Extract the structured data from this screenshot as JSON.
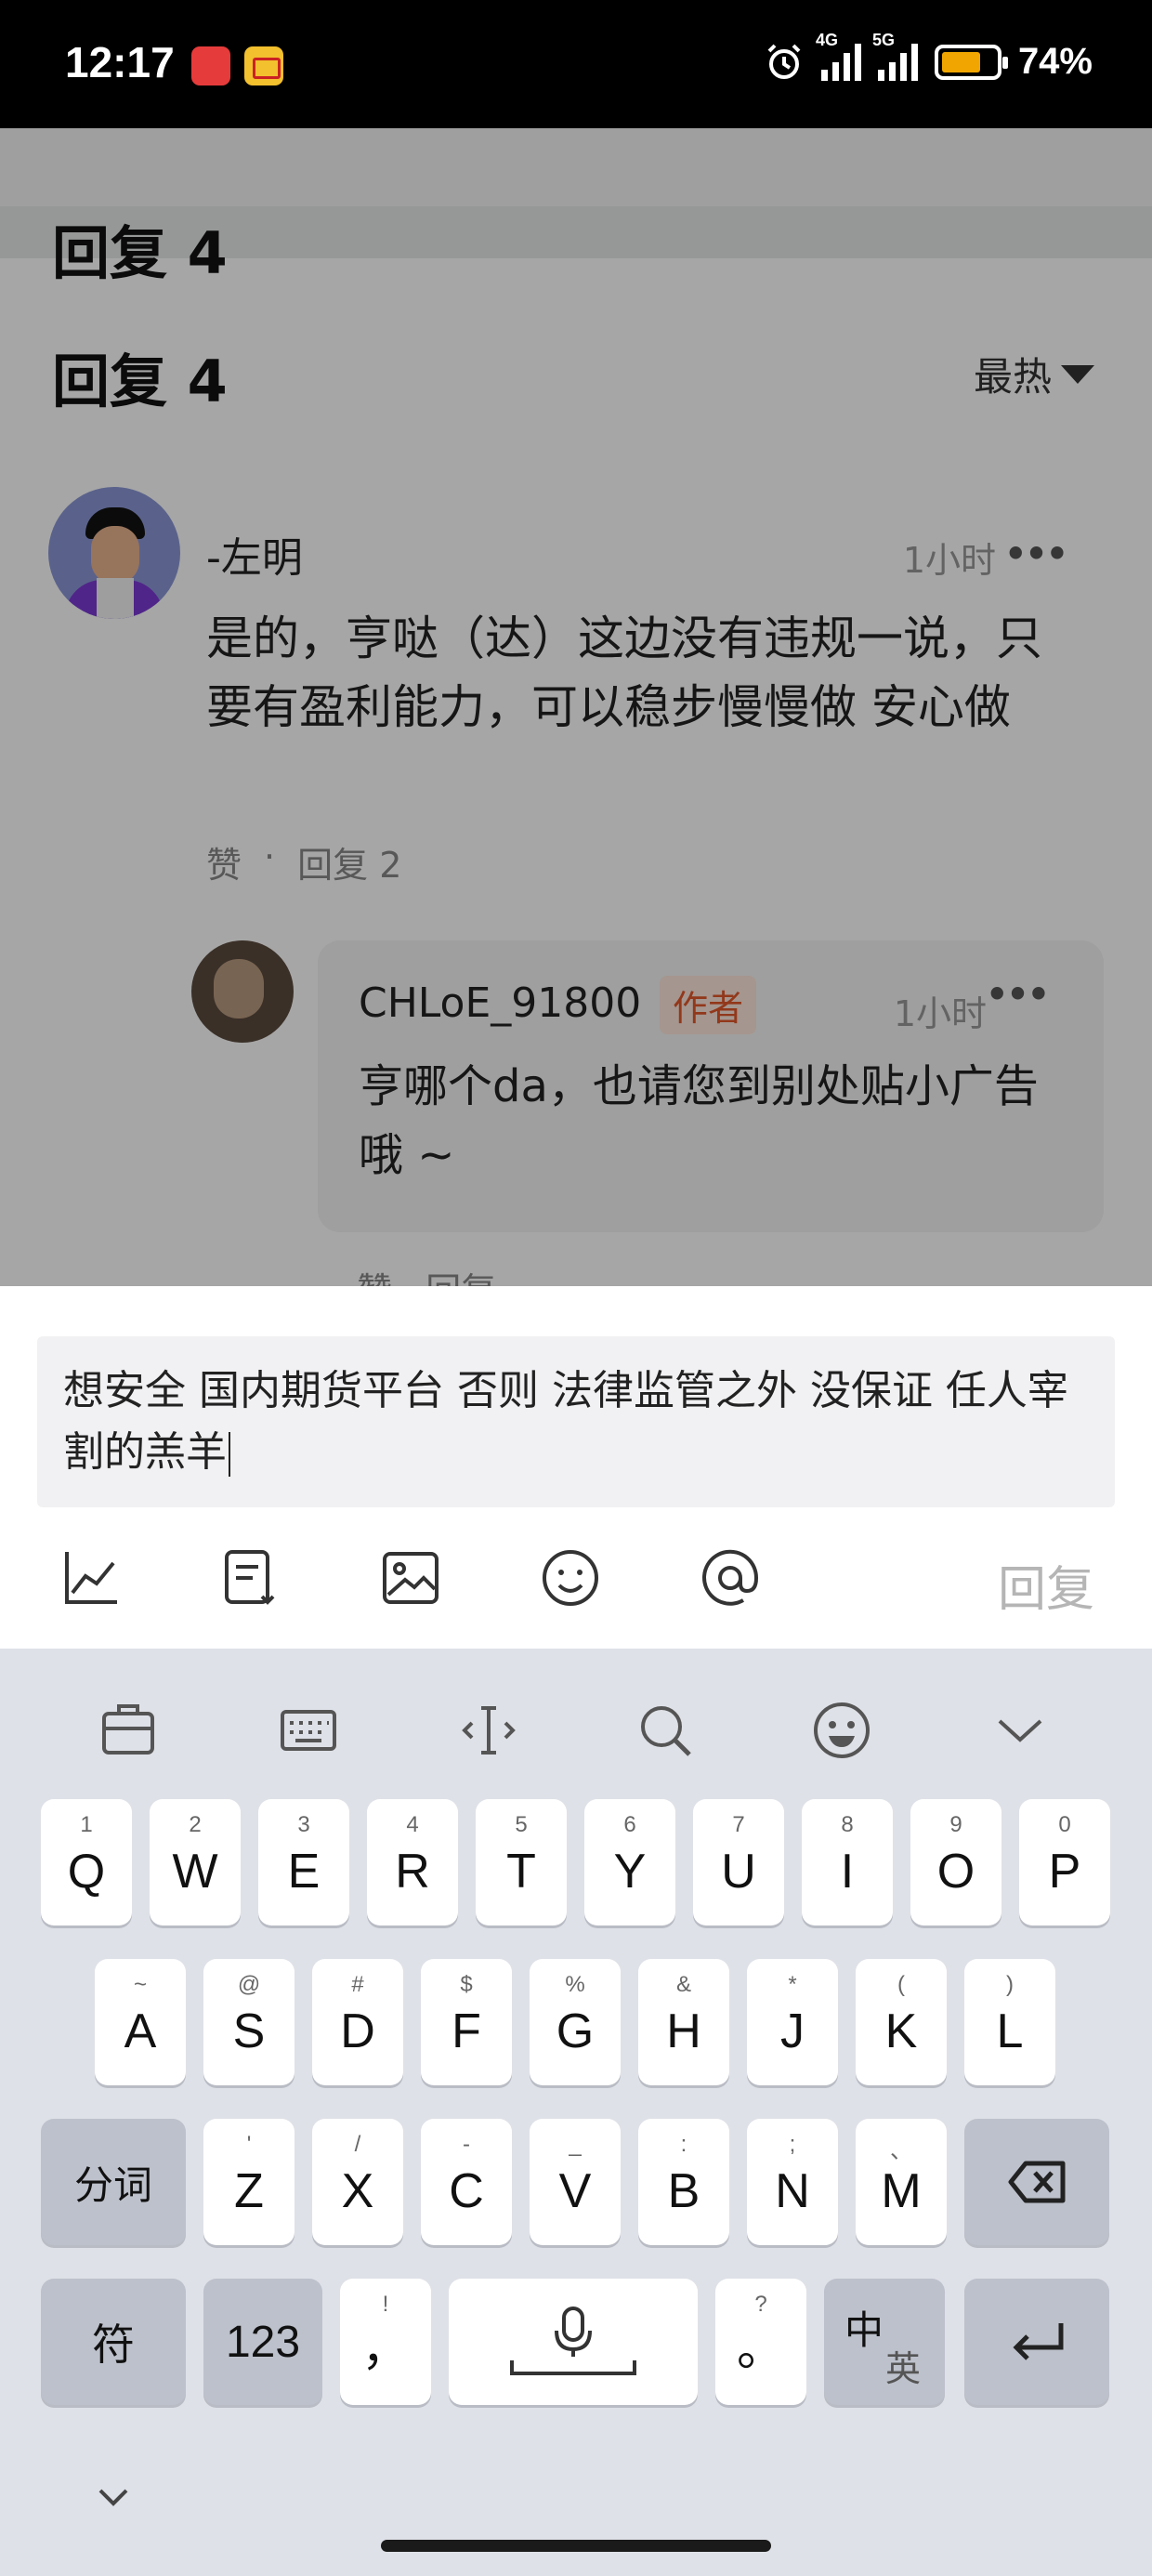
{
  "status_bar": {
    "time": "12:17",
    "net1": "4G",
    "net2": "5G",
    "battery": "74%"
  },
  "comments": {
    "header": "回复 4",
    "sort_label": "最热",
    "main": {
      "user": "-左明",
      "time": "1小时",
      "more": "•••",
      "text": "是的，亨哒（达）这边没有违规一说，只要有盈利能力，可以稳步慢慢做 安心做",
      "like": "赞",
      "dot": "·",
      "reply": "回复 2"
    },
    "sub": {
      "user": "CHLoE_91800",
      "author_tag": "作者",
      "time": "1小时",
      "more": "•••",
      "text": "亨哪个da，也请您到别处贴小广告哦 ~",
      "actions": "赞 · 回复"
    }
  },
  "composer": {
    "input_value": "想安全 国内期货平台 否则 法律监管之外 没保证 任人宰割的羔羊",
    "reply_button": "回复",
    "tools": [
      "chart-icon",
      "note-icon",
      "image-icon",
      "emoji-icon",
      "at-icon"
    ]
  },
  "keyboard": {
    "toolbar": [
      "clipboard-icon",
      "keyboard-icon",
      "cursor-icon",
      "search-icon",
      "emoji-icon",
      "chevron-down-icon"
    ],
    "row1": [
      {
        "key": "Q",
        "sub": "1"
      },
      {
        "key": "W",
        "sub": "2"
      },
      {
        "key": "E",
        "sub": "3"
      },
      {
        "key": "R",
        "sub": "4"
      },
      {
        "key": "T",
        "sub": "5"
      },
      {
        "key": "Y",
        "sub": "6"
      },
      {
        "key": "U",
        "sub": "7"
      },
      {
        "key": "I",
        "sub": "8"
      },
      {
        "key": "O",
        "sub": "9"
      },
      {
        "key": "P",
        "sub": "0"
      }
    ],
    "row2": [
      {
        "key": "A",
        "sub": "~"
      },
      {
        "key": "S",
        "sub": "@"
      },
      {
        "key": "D",
        "sub": "#"
      },
      {
        "key": "F",
        "sub": "$"
      },
      {
        "key": "G",
        "sub": "%"
      },
      {
        "key": "H",
        "sub": "&"
      },
      {
        "key": "J",
        "sub": "*"
      },
      {
        "key": "K",
        "sub": "("
      },
      {
        "key": "L",
        "sub": ")"
      }
    ],
    "row3": [
      {
        "key": "Z",
        "sub": "'"
      },
      {
        "key": "X",
        "sub": "/"
      },
      {
        "key": "C",
        "sub": "-"
      },
      {
        "key": "V",
        "sub": "_"
      },
      {
        "key": "B",
        "sub": ":"
      },
      {
        "key": "N",
        "sub": ";"
      },
      {
        "key": "M",
        "sub": "、"
      }
    ],
    "segment_key": "分词",
    "symbol_key": "符",
    "num_key": "123",
    "comma_key": "，",
    "comma_sub": "!",
    "period_key": "。",
    "period_sub": "?",
    "lang_main": "中",
    "lang_alt": "英"
  }
}
